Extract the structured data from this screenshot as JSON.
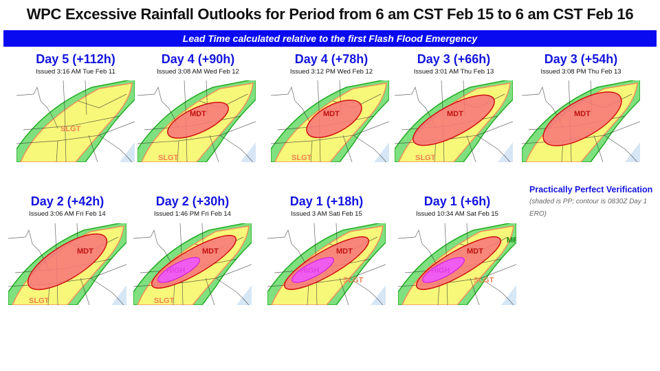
{
  "header": {
    "title": "WPC Excessive Rainfall Outlooks for Period from 6 am CST Feb 15 to 6 am CST Feb 16",
    "banner": "Lead Time calculated relative to the first Flash Flood Emergency"
  },
  "colors": {
    "banner": "#0a0af0",
    "title_blue": "#1414e0",
    "marginal": "#7ee07e",
    "slight": "#f7f77a",
    "moderate": "#f77a7a",
    "high": "#f05cf0",
    "water": "#d6e6f5"
  },
  "panels": [
    {
      "title": "Day 5 (+112h)",
      "issued": "Issued 3:16 AM Tue Feb 11",
      "labels": {
        "slgt": "SLGT"
      },
      "mdt": false,
      "high": false
    },
    {
      "title": "Day 4 (+90h)",
      "issued": "Issued 3:08 AM Wed Feb 12",
      "labels": {
        "slgt": "SLGT",
        "mdt": "MDT"
      },
      "mdt": true,
      "high": false
    },
    {
      "title": "Day 4 (+78h)",
      "issued": "Issued 3:12 PM Wed Feb 12",
      "labels": {
        "slgt": "SLGT",
        "mdt": "MDT"
      },
      "mdt": true,
      "high": false
    },
    {
      "title": "Day 3 (+66h)",
      "issued": "Issued 3:01 AM Thu Feb 13",
      "labels": {
        "slgt": "SLGT",
        "mdt": "MDT"
      },
      "mdt": true,
      "high": false
    },
    {
      "title": "Day 3 (+54h)",
      "issued": "Issued 3:08 PM Thu Feb 13",
      "labels": {
        "mdt": "MDT"
      },
      "mdt": true,
      "high": false
    },
    {
      "title": "Day 2 (+42h)",
      "issued": "Issued 3:06 AM Fri Feb 14",
      "labels": {
        "slgt": "SLGT",
        "mdt": "MDT"
      },
      "mdt": true,
      "high": false
    },
    {
      "title": "Day 2 (+30h)",
      "issued": "Issued 1:46 PM Fri Feb 14",
      "labels": {
        "slgt": "SLGT",
        "mdt": "MDT",
        "high": "HIGH"
      },
      "mdt": true,
      "high": true
    },
    {
      "title": "Day 1 (+18h)",
      "issued": "Issued 3 AM Sati Feb 15",
      "labels": {
        "slgt": "SLGT",
        "mdt": "MDT",
        "high": "HIGH"
      },
      "mdt": true,
      "high": true
    },
    {
      "title": "Day 1 (+6h)",
      "issued": "Issued 10:34 AM Sat Feb 15",
      "labels": {
        "slgt": "SLGT",
        "mdt": "MDT",
        "high": "HIGH",
        "mrgl": "MR"
      },
      "mdt": true,
      "high": true
    }
  ],
  "legend_note": {
    "bold": "Practically Perfect Verification",
    "italic": "(shaded is PP; contour is 0830Z Day 1 ERO)"
  }
}
